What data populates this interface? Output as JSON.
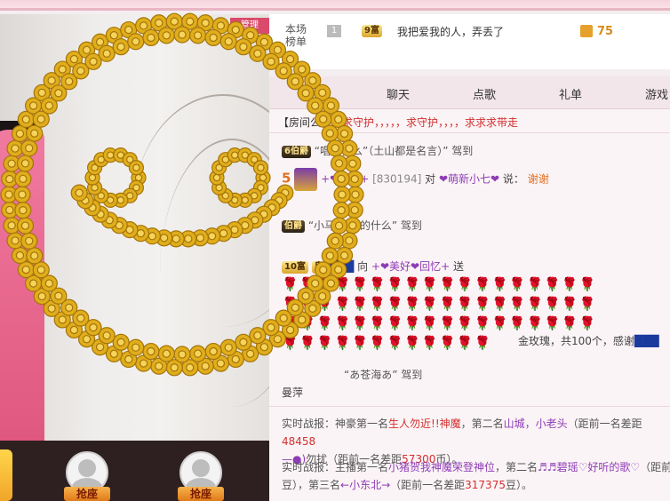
{
  "video": {
    "corner_tag": "管理"
  },
  "rank": {
    "title": "本场\n榜单",
    "position": "1",
    "badge": "9富",
    "message": "我把爱我的人，弄丢了",
    "coin_count": "75"
  },
  "tabs": [
    {
      "label": "聊天"
    },
    {
      "label": "点歌"
    },
    {
      "label": "礼单"
    },
    {
      "label": "游戏"
    }
  ],
  "chat": {
    "notice_prefix": "【房间公告】",
    "notice_text": "求守护，，，，，求守护，，，，求求求带走",
    "line1_badge": "6伯爵",
    "line1_text": "“唱的什么”（土山都是名言）” 驾到",
    "line2_num": "5",
    "line2_name": "+❤回忆+",
    "line2_id": "[830194]",
    "line2_to": "对",
    "line2_target": "❤萌新小七❤",
    "line2_say": "说：",
    "line2_msg": "谢谢",
    "line3_badge": "伯爵",
    "line3_text": "“小马哥 装的什么” 驾到",
    "line4_badge": "10富",
    "line4_badge2": "皇",
    "line4_sender": "+❤美好❤回忆+",
    "line4_to": "向",
    "line4_send": "送",
    "gift_summary": "金玫瑰，共100个，感谢",
    "line5_text": "“あ苍海あ” 驾到",
    "line5_sub": "曼萍",
    "battle1_a": "实时战报：神豪第一名",
    "battle1_name1": "生人勿近!!神魔",
    "battle1_b": "，第二名",
    "battle1_name2": "山城，小老头",
    "battle1_c": "（距前一名差距",
    "battle1_gap1": "48458",
    "battle1_d": "—●)",
    "battle1_e": "勿扰（距前一名差距",
    "battle1_gap2": "57300",
    "battle1_f": "币）。",
    "battle2_a": "实时战报：主播第一名",
    "battle2_name1": "小猪贺我神魔荣登神位",
    "battle2_b": "，第二名",
    "battle2_name2": "♬♬碧瑶♡好听的歌♡",
    "battle2_c": "（距前",
    "battle2_d": "豆），第三名",
    "battle2_name3": "←小东北→",
    "battle2_e": "（距前一名差距",
    "battle2_gap": "317375",
    "battle2_f": "豆）。"
  },
  "seats": [
    {
      "label": "抢座"
    },
    {
      "label": "抢座"
    }
  ],
  "icons": [
    "rose-smiley-icon",
    "coin-icon",
    "avatar-icon",
    "user-placeholder-icon"
  ],
  "colors": {
    "accent": "#e8658d",
    "gold": "#d49a13",
    "red": "#d32f2f",
    "purple": "#8e3bb5"
  }
}
